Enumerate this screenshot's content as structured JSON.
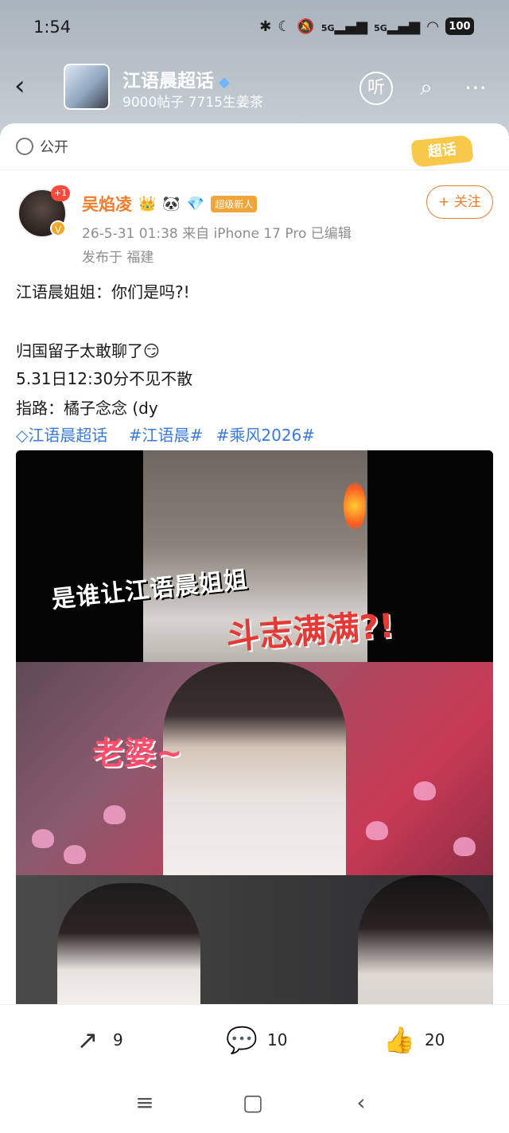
{
  "status_bar": {
    "time": "1:54",
    "icons": [
      "bluetooth-icon",
      "moon-icon",
      "mute-icon",
      "signal-5g-icon",
      "signal-5g-icon",
      "wifi-icon"
    ],
    "sig1": "5G",
    "sig2": "5G",
    "battery": "100"
  },
  "header": {
    "topic_title": "江语晨超话",
    "topic_stats": "9000帖子 7715生姜茶",
    "icons": [
      "back-icon",
      "listen-icon",
      "search-icon",
      "more-icon"
    ],
    "listen_label": "听"
  },
  "card": {
    "visibility": "公开",
    "super_topic_tag": "超话"
  },
  "post": {
    "author": "吴焰凌",
    "badge_plus": "+1",
    "badge_new": "超级新人",
    "meta": "26-5-31 01:38  来自 iPhone 17 Pro  已编辑",
    "location": "发布于 福建",
    "follow_label": "+ 关注",
    "lines": [
      "江语晨姐姐：你们是吗?!",
      "归国留子太敢聊了😏",
      "5.31日12:30分不见不散",
      "指路：橘子念念 (dy"
    ],
    "tags": [
      "江语晨超话",
      "#江语晨#",
      "#乘风2026#"
    ],
    "image_captions": [
      "是谁让江语晨姐姐",
      "斗志满满?!",
      "老婆~"
    ]
  },
  "actions": {
    "repost_count": "9",
    "comment_count": "10",
    "like_count": "20"
  },
  "colors": {
    "accent_orange": "#ef7d2e",
    "tag_blue": "#3a7ad8",
    "like_orange": "#f58a2a"
  }
}
